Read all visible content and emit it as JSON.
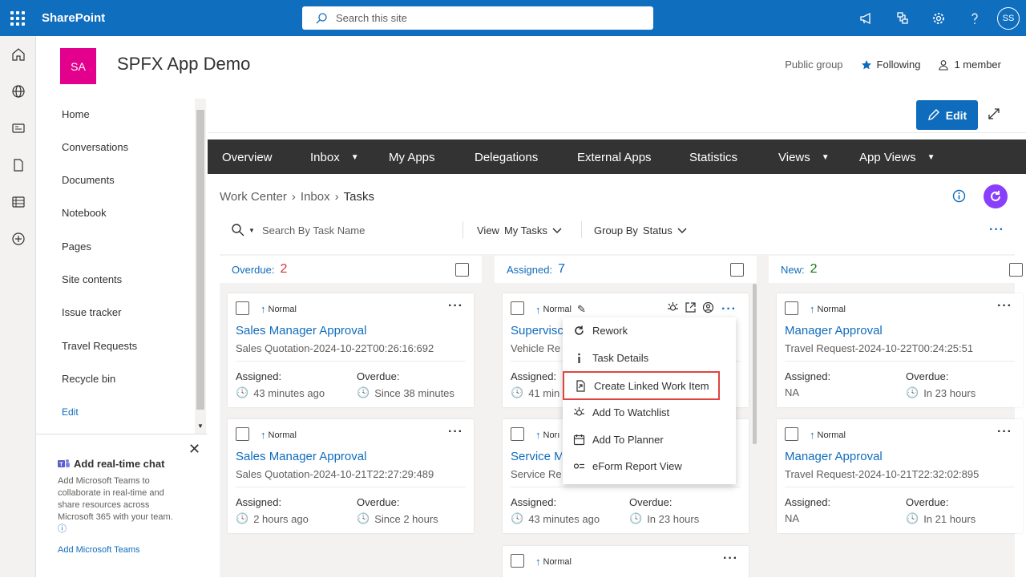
{
  "topbar": {
    "brand": "SharePoint",
    "search_placeholder": "Search this site",
    "avatar_initials": "SS"
  },
  "site": {
    "logo": "SA",
    "title": "SPFX App Demo",
    "group_type": "Public group",
    "following": "Following",
    "members": "1 member"
  },
  "leftnav": {
    "items": [
      "Home",
      "Conversations",
      "Documents",
      "Notebook",
      "Pages",
      "Site contents",
      "Issue tracker",
      "Travel Requests",
      "Recycle bin"
    ],
    "edit": "Edit"
  },
  "chat": {
    "title": "Add real-time chat",
    "desc": "Add Microsoft Teams to collaborate in real-time and share resources across Microsoft 365 with your team.",
    "link": "Add Microsoft Teams"
  },
  "page": {
    "edit_label": "Edit"
  },
  "menubar": {
    "items": [
      "Overview",
      "Inbox",
      "My Apps",
      "Delegations",
      "External Apps",
      "Statistics",
      "Views",
      "App Views"
    ]
  },
  "breadcrumb": {
    "items": [
      "Work Center",
      "Inbox",
      "Tasks"
    ]
  },
  "toolbar": {
    "search_placeholder": "Search By Task Name",
    "view_label": "View",
    "view_value": "My Tasks",
    "group_label": "Group By",
    "group_value": "Status"
  },
  "columns": [
    {
      "label": "Overdue:",
      "count": "2",
      "count_color": "#d13438"
    },
    {
      "label": "Assigned:",
      "count": "7",
      "count_color": "#0f6cbd"
    },
    {
      "label": "New:",
      "count": "2",
      "count_color": "#107c10"
    }
  ],
  "cards": {
    "c0a": {
      "priority": "Normal",
      "title": "Sales Manager Approval",
      "ref": "Sales Quotation-2024-10-22T00:26:16:692",
      "assigned_label": "Assigned:",
      "assigned_value": "43 minutes ago",
      "overdue_label": "Overdue:",
      "overdue_value": "Since 38 minutes"
    },
    "c0b": {
      "priority": "Normal",
      "title": "Sales Manager Approval",
      "ref": "Sales Quotation-2024-10-21T22:27:29:489",
      "assigned_label": "Assigned:",
      "assigned_value": "2 hours ago",
      "overdue_label": "Overdue:",
      "overdue_value": "Since 2 hours"
    },
    "c1a": {
      "priority": "Normal",
      "title": "Supervisc",
      "ref": "Vehicle Re",
      "assigned_label": "Assigned:",
      "assigned_value": "41 min"
    },
    "c1b": {
      "priority": "Norı",
      "title": "Service M",
      "ref": "Service Re",
      "assigned_label": "Assigned:",
      "assigned_value": "43 minutes ago",
      "overdue_label": "Overdue:",
      "overdue_value": "In 23 hours"
    },
    "c1c": {
      "priority": "Normal"
    },
    "c2a": {
      "priority": "Normal",
      "title": "Manager Approval",
      "ref": "Travel Request-2024-10-22T00:24:25:51",
      "assigned_label": "Assigned:",
      "assigned_value": "NA",
      "overdue_label": "Overdue:",
      "overdue_value": "In 23 hours"
    },
    "c2b": {
      "priority": "Normal",
      "title": "Manager Approval",
      "ref": "Travel Request-2024-10-21T22:32:02:895",
      "assigned_label": "Assigned:",
      "assigned_value": "NA",
      "overdue_label": "Overdue:",
      "overdue_value": "In 21 hours"
    }
  },
  "context_menu": {
    "items": [
      "Rework",
      "Task Details",
      "Create Linked Work Item",
      "Add To Watchlist",
      "Add To Planner",
      "eForm Report View"
    ]
  },
  "colors": {
    "suite_bar": "#106ebe",
    "accent": "#0f6cbd",
    "menubar": "#333333",
    "highlight": "#e0443f",
    "logo": "#e3008c"
  }
}
